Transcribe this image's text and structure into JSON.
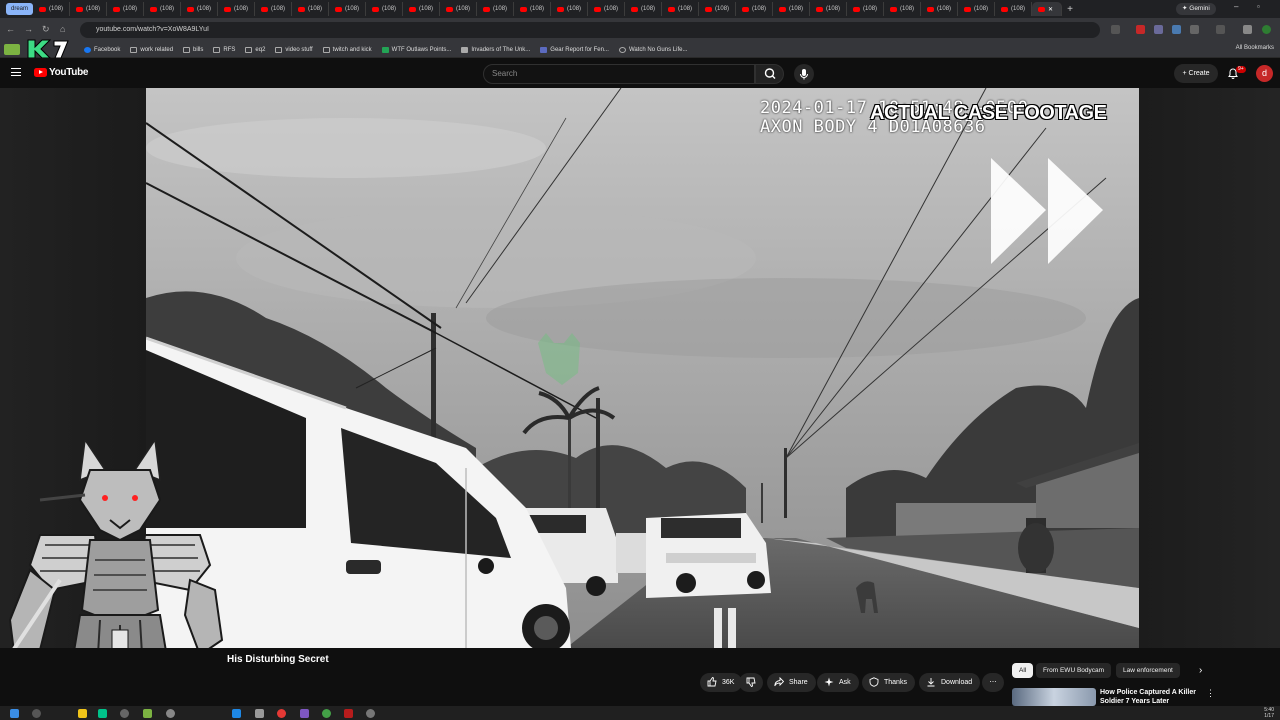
{
  "browser": {
    "tab_group_label": "dream",
    "tab_label": "(108)",
    "tab_count": 28,
    "gemini_label": "Gemini",
    "url": "youtube.com/watch?v=XoW8A9LYuI",
    "bookmarks": [
      "Facebook",
      "work related",
      "bills",
      "RFS",
      "eq2",
      "video stuff",
      "twitch and kick",
      "WTF Outlaws Points...",
      "Invaders of The Unk...",
      "Gear Report for Fen...",
      "Watch No Guns Life..."
    ],
    "all_bookmarks": "All Bookmarks"
  },
  "header": {
    "logo_text": "YouTube",
    "search_placeholder": "Search",
    "create_label": "Create",
    "notification_badge": "9+",
    "avatar_letter": "d"
  },
  "video": {
    "timestamp_line1": "2024-01-17 10:51:48 -0500",
    "timestamp_line2": "AXON BODY 4 D01A08636",
    "overlay_title": "ACTUAL CASE FOOTAGE"
  },
  "below_video": {
    "title": "His Disturbing Secret",
    "actions": {
      "like_count": "36K",
      "share": "Share",
      "ask": "Ask",
      "thanks": "Thanks",
      "download": "Download"
    },
    "chips": [
      "All",
      "From EWU Bodycam",
      "Law enforcement"
    ],
    "recommended_title": "How Police Captured A Killer Soldier 7 Years Later"
  },
  "colors": {
    "brand_red": "#ff0000",
    "background": "#0f0f0f",
    "button_bg": "#272727"
  }
}
